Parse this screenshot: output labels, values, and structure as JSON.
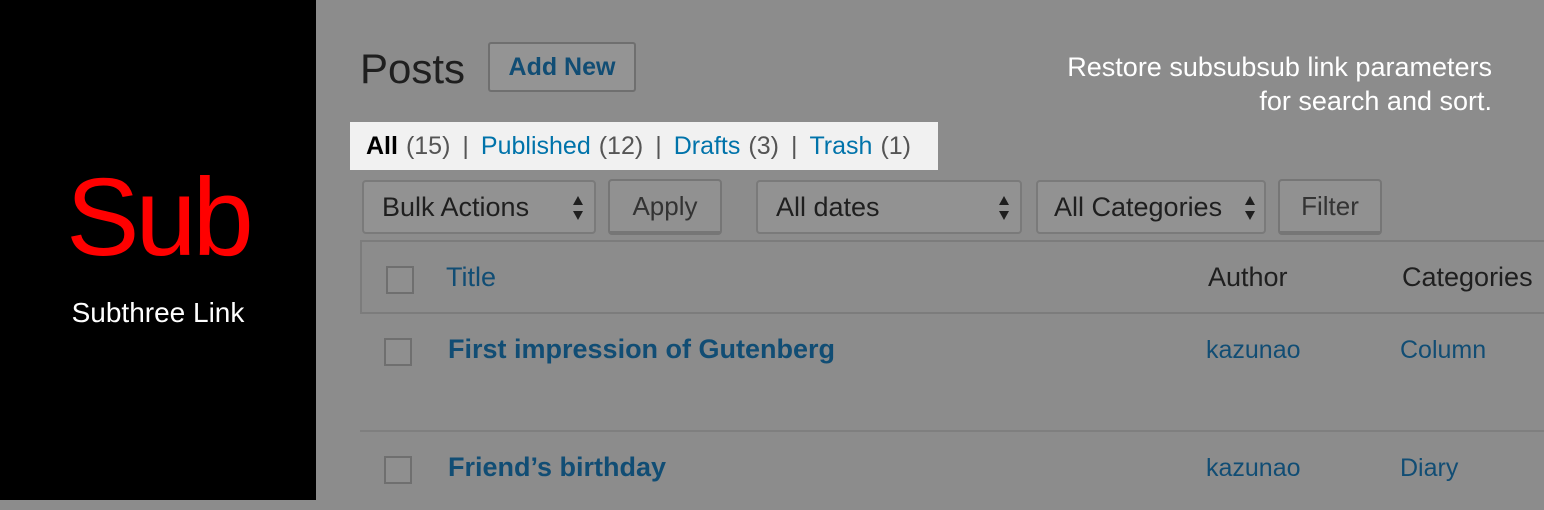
{
  "brand": {
    "logo": "Sub",
    "subtitle": "Subthree Link",
    "logo_color": "#ff0000"
  },
  "header": {
    "title": "Posts",
    "add_new_label": "Add New"
  },
  "promo": {
    "line1": "Restore subsubsub link parameters",
    "line2": "for search and sort."
  },
  "views": {
    "all_label": "All",
    "all_count": "(15)",
    "published_label": "Published",
    "published_count": "(12)",
    "drafts_label": "Drafts",
    "drafts_count": "(3)",
    "trash_label": "Trash",
    "trash_count": "(1)",
    "separator": "|"
  },
  "filters": {
    "bulk_actions": "Bulk Actions",
    "apply_label": "Apply",
    "dates": "All dates",
    "categories": "All Categories",
    "filter_label": "Filter"
  },
  "table": {
    "headers": {
      "title": "Title",
      "author": "Author",
      "categories": "Categories"
    },
    "rows": [
      {
        "title": "First impression of Gutenberg",
        "author": "kazunao",
        "category": "Column"
      },
      {
        "title": "Friend’s birthday",
        "author": "kazunao",
        "category": "Diary"
      }
    ]
  },
  "colors": {
    "overlay_gray": "#8c8c8c",
    "link_blue": "#114d74",
    "highlight_bg": "#f1f1f1"
  }
}
